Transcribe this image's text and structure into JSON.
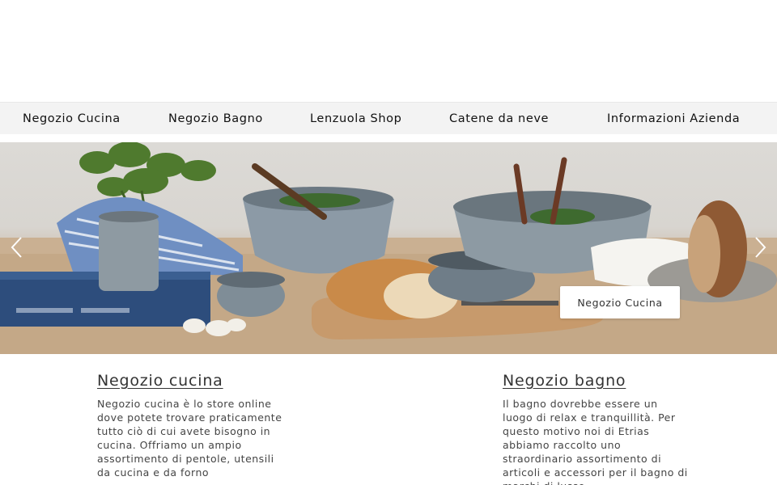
{
  "nav": {
    "items": [
      {
        "label": "Negozio Cucina"
      },
      {
        "label": "Negozio Bagno"
      },
      {
        "label": "Lenzuola Shop"
      },
      {
        "label": "Catene da neve"
      },
      {
        "label": "Informazioni Azienda"
      }
    ]
  },
  "hero": {
    "button_label": "Negozio Cucina",
    "prev_icon": "chevron-left-icon",
    "next_icon": "chevron-right-icon"
  },
  "sections": {
    "left": {
      "title": "Negozio cucina",
      "text": "Negozio cucina è lo store online dove potete trovare praticamente tutto ciò di cui avete bisogno in cucina. Offriamo un ampio assortimento di pentole, utensili da cucina e da forno"
    },
    "right": {
      "title": "Negozio bagno",
      "text": "Il bagno dovrebbe essere un luogo di relax e tranquillità. Per questo motivo noi di Etrias abbiamo raccolto uno straordinario assortimento di articoli e accessori per il bagno di marchi di lusso"
    }
  }
}
